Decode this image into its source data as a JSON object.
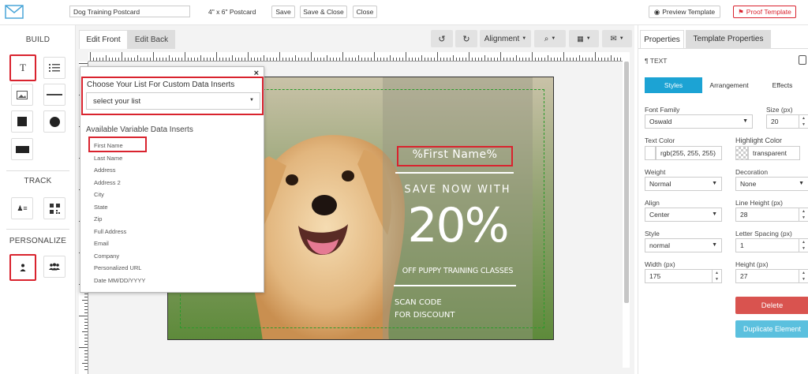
{
  "topbar": {
    "doc_name": "Dog Training Postcard",
    "size_label": "4\" x 6\" Postcard",
    "save": "Save",
    "save_close": "Save & Close",
    "close": "Close",
    "preview": "Preview Template",
    "proof": "Proof Template"
  },
  "left": {
    "build": "BUILD",
    "track": "TRACK",
    "personalize": "PERSONALIZE",
    "text_tool": "T"
  },
  "canvas": {
    "tab_front": "Edit Front",
    "tab_back": "Edit Back",
    "alignment": "Alignment",
    "undo_icon": "undo-icon",
    "redo_icon": "redo-icon"
  },
  "postcard": {
    "first_name": "%First Name%",
    "save_now": "SAVE NOW WITH",
    "percent": "20%",
    "off_text": "OFF PUPPY TRAINING CLASSES",
    "scan_line1": "SCAN CODE",
    "scan_line2": "FOR DISCOUNT"
  },
  "popup": {
    "close": "×",
    "title": "Choose Your List For Custom Data Inserts",
    "select_value": "select your list",
    "available": "Available Variable Data Inserts",
    "items": [
      "First Name",
      "Last Name",
      "Address",
      "Address 2",
      "City",
      "State",
      "Zip",
      "Full Address",
      "Email",
      "Company",
      "Personalized URL",
      "Date MM/DD/YYYY"
    ]
  },
  "right": {
    "tab_properties": "Properties",
    "tab_template": "Template Properties",
    "section": "¶ TEXT",
    "sub_styles": "Styles",
    "sub_arrangement": "Arrangement",
    "sub_effects": "Effects",
    "font_family_label": "Font Family",
    "font_family": "Oswald",
    "size_label": "Size (px)",
    "size": "20",
    "text_color_label": "Text Color",
    "text_color": "rgb(255, 255, 255)",
    "highlight_label": "Highlight Color",
    "highlight": "transparent",
    "weight_label": "Weight",
    "weight": "Normal",
    "decoration_label": "Decoration",
    "decoration": "None",
    "align_label": "Align",
    "align": "Center",
    "line_height_label": "Line Height (px)",
    "line_height": "28",
    "style_label": "Style",
    "style": "normal",
    "letter_spacing_label": "Letter Spacing (px)",
    "letter_spacing": "1",
    "width_label": "Width (px)",
    "width": "175",
    "height_label": "Height (px)",
    "height": "27",
    "delete": "Delete",
    "duplicate": "Duplicate Element"
  },
  "colors": {
    "accent_blue": "#1ca3d4",
    "delete_red": "#d9534f",
    "duplicate_blue": "#5bc0de",
    "highlight_red": "#d9232e"
  }
}
